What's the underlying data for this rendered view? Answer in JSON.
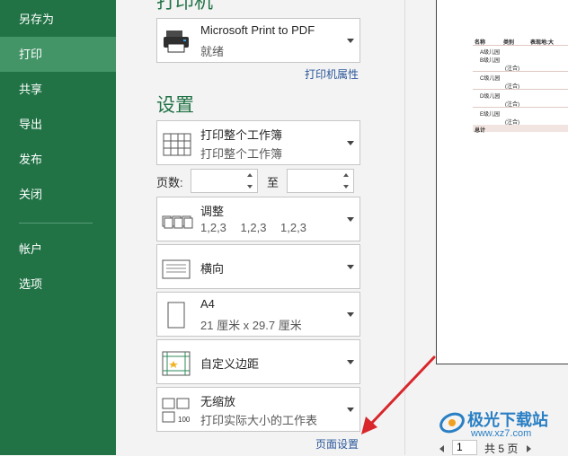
{
  "sidebar": {
    "items": [
      {
        "label": "另存为"
      },
      {
        "label": "打印"
      },
      {
        "label": "共享"
      },
      {
        "label": "导出"
      },
      {
        "label": "发布"
      },
      {
        "label": "关闭"
      },
      {
        "label": "帐户"
      },
      {
        "label": "选项"
      }
    ],
    "active": "打印"
  },
  "printer": {
    "section_title": "打印机",
    "name": "Microsoft Print to PDF",
    "status": "就绪",
    "properties_link": "打印机属性"
  },
  "settings": {
    "section_title": "设置",
    "what_to_print": {
      "title": "打印整个工作簿",
      "subtitle": "打印整个工作簿"
    },
    "pages_label": "页数:",
    "pages_to_label": "至",
    "pages_from": "",
    "pages_to": "",
    "collation": {
      "title": "调整",
      "subtitle": "1,2,3 1,2,3 1,2,3"
    },
    "orientation": {
      "title": "横向"
    },
    "paper": {
      "title": "A4",
      "subtitle": "21 厘米 x 29.7 厘米"
    },
    "margins": {
      "title": "自定义边距"
    },
    "scaling": {
      "title": "无缩放",
      "subtitle": "打印实际大小的工作表"
    },
    "page_setup_link": "页面设置"
  },
  "preview": {
    "headers": [
      "名称",
      "类别",
      "表现地:大"
    ],
    "rows": [
      "A级儿园",
      "B级儿园",
      "C级儿园",
      "D级儿园",
      "E级儿园"
    ],
    "subtotal": "(注合)",
    "total": "总计"
  },
  "pager": {
    "current": "1",
    "total_text": "共 5 页"
  },
  "watermark": {
    "text": "极光下载站",
    "url": "www.xz7.com"
  },
  "colors": {
    "sidebar": "#217346",
    "sidebar_active": "#439467",
    "accent_text": "#217346",
    "link": "#2b579a",
    "annotation_arrow": "#d9262b"
  }
}
